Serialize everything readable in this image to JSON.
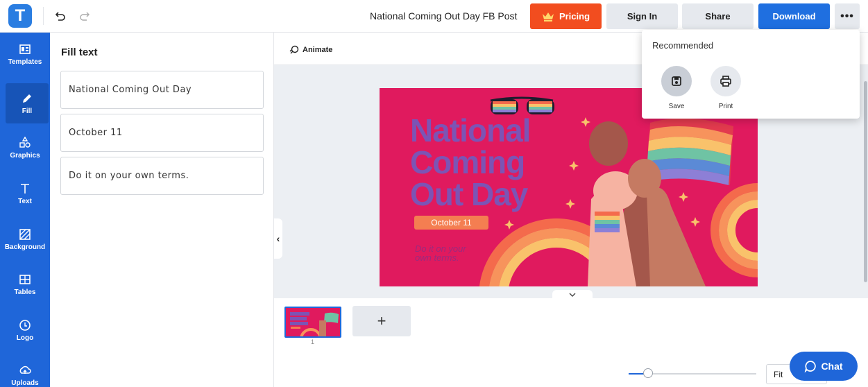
{
  "topbar": {
    "logo_letter": "T",
    "doc_title": "National Coming Out Day FB Post",
    "pricing_label": "Pricing",
    "signin_label": "Sign In",
    "share_label": "Share",
    "download_label": "Download",
    "more_label": "•••"
  },
  "rail": {
    "items": [
      {
        "label": "Templates",
        "icon": "templates-icon"
      },
      {
        "label": "Fill",
        "icon": "pencil-icon"
      },
      {
        "label": "Graphics",
        "icon": "shapes-icon"
      },
      {
        "label": "Text",
        "icon": "text-icon"
      },
      {
        "label": "Background",
        "icon": "background-icon"
      },
      {
        "label": "Tables",
        "icon": "table-icon"
      },
      {
        "label": "Logo",
        "icon": "logo-icon"
      },
      {
        "label": "Uploads",
        "icon": "upload-icon"
      }
    ]
  },
  "panel": {
    "title": "Fill text",
    "fields": [
      "National Coming Out Day",
      "October 11",
      "Do it on your own terms."
    ]
  },
  "workspace": {
    "animate_label": "Animate"
  },
  "design": {
    "headline_1": "National",
    "headline_2": "Coming",
    "headline_3": "Out Day",
    "date": "October 11",
    "tagline_1": "Do it on your",
    "tagline_2": "own terms."
  },
  "pages": {
    "page_number": "1",
    "add_label": "+"
  },
  "zoom": {
    "fit_label": "Fit",
    "slider_fraction": 0.15
  },
  "chat": {
    "label": "Chat"
  },
  "dropdown": {
    "title": "Recommended",
    "save_label": "Save",
    "print_label": "Print"
  },
  "colors": {
    "brand_blue": "#1f66d9",
    "pricing_orange": "#f24d1f",
    "canvas_pink": "#e01a5e",
    "headline_purple": "#7c54b5"
  }
}
